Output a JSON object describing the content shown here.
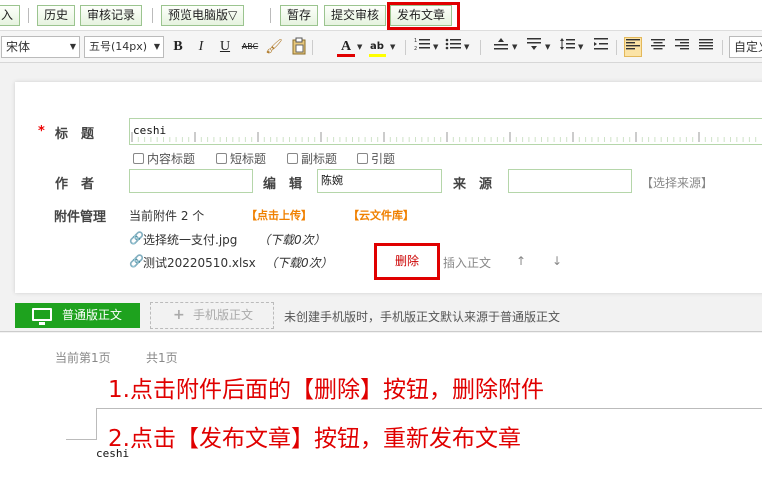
{
  "toolbar": {
    "import_label": "入",
    "history_label": "历史",
    "review_record_label": "审核记录",
    "preview_label": "预览电脑版▽",
    "draft_label": "暂存",
    "submit_review_label": "提交审核",
    "publish_label": "发布文章"
  },
  "editor_toolbar": {
    "font_family": "宋体",
    "font_size": "五号(14px)",
    "bold": "B",
    "italic": "I",
    "underline": "U",
    "strikethrough": "ABC",
    "font_color_letter": "A",
    "font_color": "#e00000",
    "highlight_letter": "ab",
    "highlight_color": "#ffff00",
    "custom_label": "自定义"
  },
  "form": {
    "title_label": "标　题",
    "required_mark": "*",
    "title_value": "ceshi",
    "checkboxes": [
      "内容标题",
      "短标题",
      "副标题",
      "引题"
    ],
    "author_label": "作　者",
    "author_value": "",
    "editor_label": "编　辑",
    "editor_value": "陈婉",
    "source_label": "来　源",
    "source_value": "",
    "choose_source": "【选择来源】",
    "attachments_label": "附件管理",
    "attachment_count_text": "当前附件 2 个",
    "upload_link": "【点击上传】",
    "cloud_link": "【云文件库】",
    "attachments": [
      {
        "name": "选择统一支付.jpg",
        "downloads": "（下载0次）"
      },
      {
        "name": "测试20220510.xlsx",
        "downloads": "（下载0次）"
      }
    ],
    "delete_label": "删除",
    "insert_body_label": "插入正文",
    "move_up": "↑",
    "move_down": "↓"
  },
  "version_bar": {
    "pc_version_label": "普通版正文",
    "mobile_version_label": "手机版正文",
    "plus": "+",
    "note": "未创建手机版时，手机版正文默认来源于普通版正文"
  },
  "editor": {
    "current_page": "当前第1页",
    "total_pages": "共1页",
    "body_text": "ceshi"
  },
  "annotations": {
    "step1": "1.点击附件后面的【删除】按钮，删除附件",
    "step2": "2.点击【发布文章】按钮，重新发布文章"
  },
  "colors": {
    "accent_green": "#1ea21e",
    "highlight_red": "#e00000",
    "link_orange": "#f08000"
  }
}
